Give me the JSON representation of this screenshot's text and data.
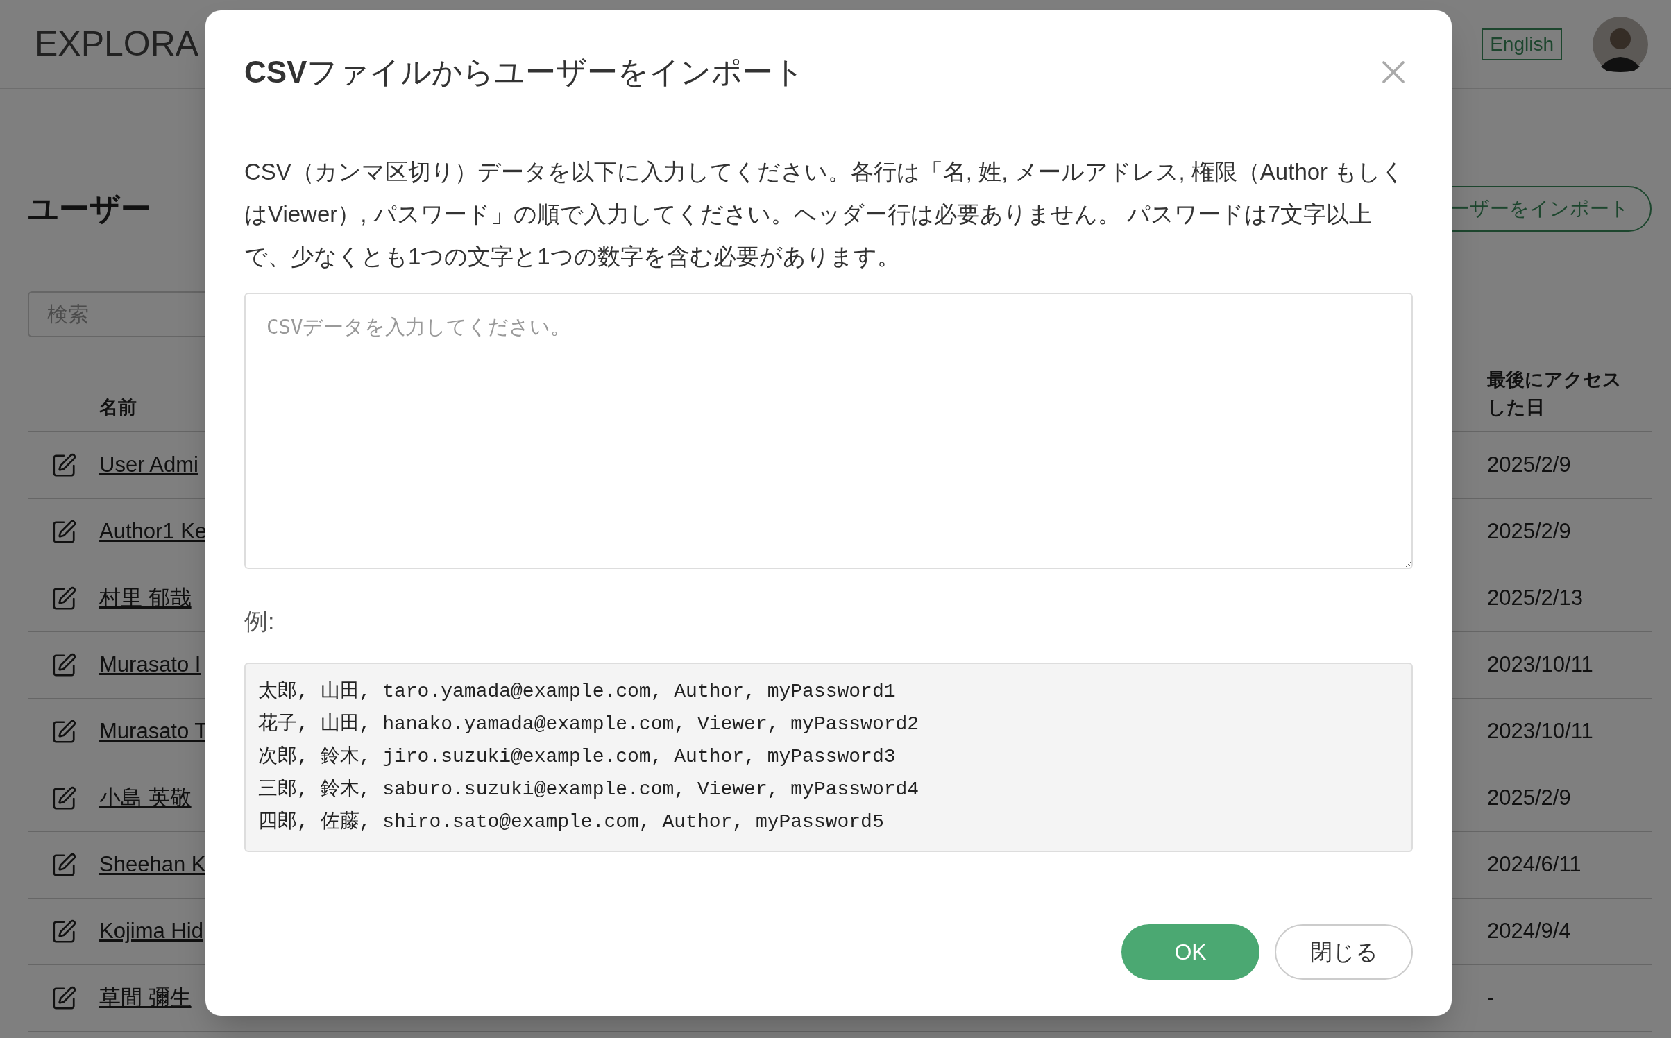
{
  "header": {
    "logo": "EXPLORA",
    "language_button": "English"
  },
  "page": {
    "title": "ユーザー",
    "import_button": "ーザーをインポート",
    "search": {
      "placeholder": "検索"
    },
    "table": {
      "columns": [
        "名前",
        "最後にアクセスした日"
      ],
      "rows": [
        {
          "name": "User Admi",
          "last_access": "2025/2/9"
        },
        {
          "name": "Author1 Ke",
          "last_access": "2025/2/9"
        },
        {
          "name": "村里 郁哉",
          "last_access": "2025/2/13"
        },
        {
          "name": "Murasato I",
          "last_access": "2023/10/11"
        },
        {
          "name": "Murasato T",
          "last_access": "2023/10/11"
        },
        {
          "name": "小島 英敬",
          "last_access": "2025/2/9"
        },
        {
          "name": "Sheehan K",
          "last_access": "2024/6/11"
        },
        {
          "name": "Kojima Hid",
          "last_access": "2024/9/4"
        },
        {
          "name": "草間 彌生",
          "last_access": "-"
        }
      ]
    }
  },
  "modal": {
    "title": "**CSV**ファイルからユーザーをインポート",
    "description": "CSV（カンマ区切り）データを以下に入力してください。各行は「名, 姓, メールアドレス, 権限（Author もしくはViewer）, パスワード」の順で入力してください。ヘッダー行は必要ありません。 パスワードは7文字以上で、少なくとも1つの文字と1つの数字を含む必要があります。",
    "textarea": {
      "placeholder": "CSVデータを入力してください。"
    },
    "example_label": "例:",
    "example_lines": [
      "太郎, 山田, taro.yamada@example.com, Author, myPassword1",
      "花子, 山田, hanako.yamada@example.com, Viewer, myPassword2",
      "次郎, 鈴木, jiro.suzuki@example.com, Author, myPassword3",
      "三郎, 鈴木, saburo.suzuki@example.com, Viewer, myPassword4",
      "四郎, 佐藤, shiro.sato@example.com, Author, myPassword5"
    ],
    "buttons": [
      {
        "label": "OK",
        "kind": "primary"
      },
      {
        "label": "閉じる",
        "kind": "secondary"
      }
    ]
  }
}
